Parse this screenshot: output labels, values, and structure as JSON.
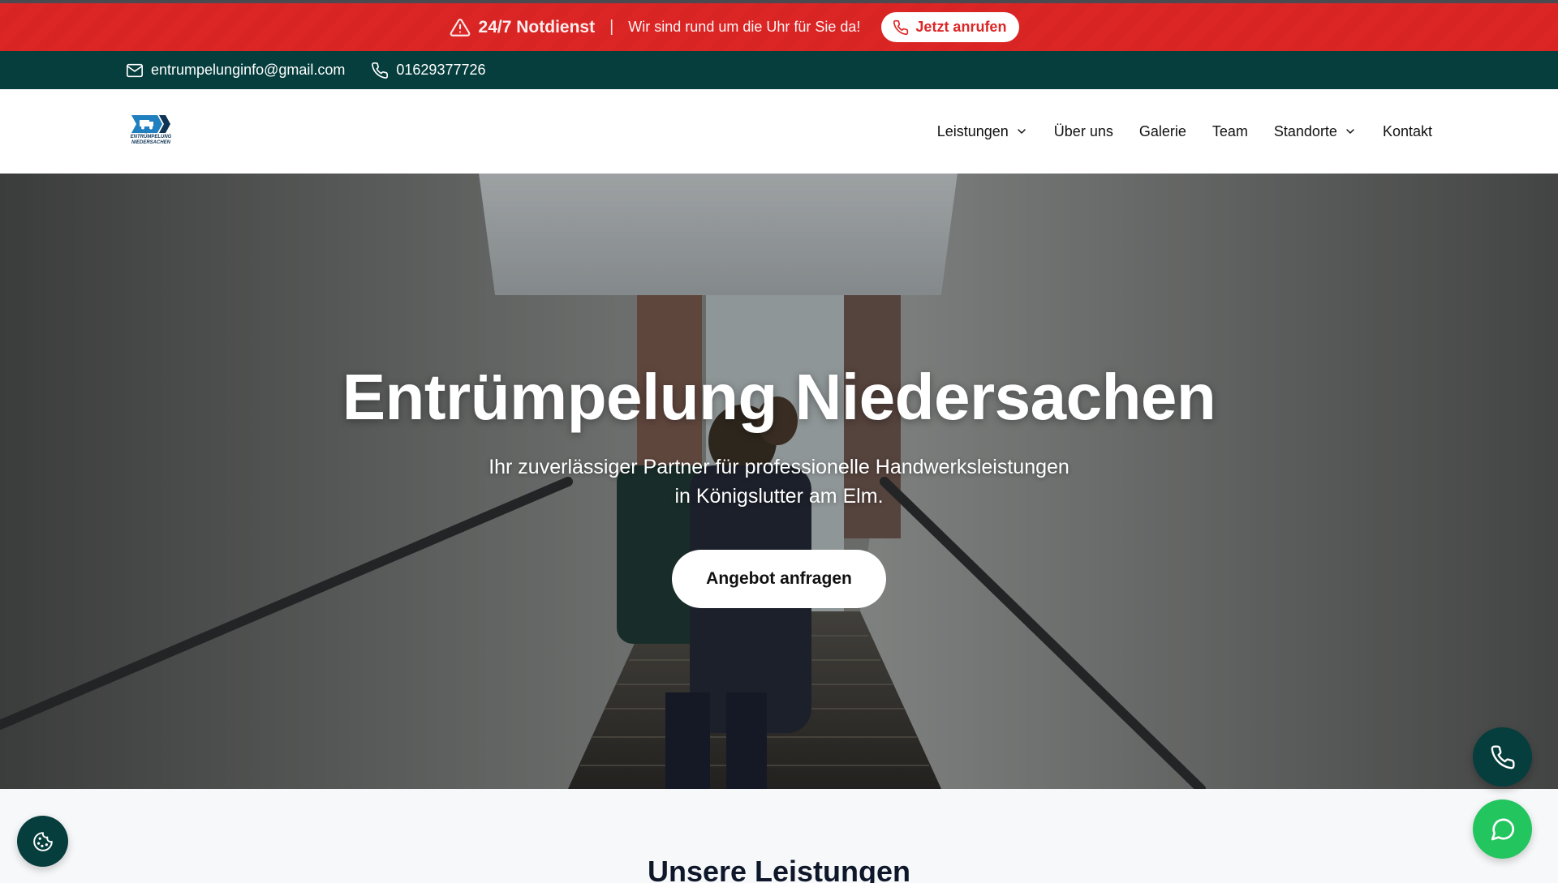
{
  "alert": {
    "title": "24/7 Notdienst",
    "separator": "|",
    "text": "Wir sind rund um die Uhr für Sie da!",
    "call_label": "Jetzt anrufen",
    "icon": "warning-triangle-icon"
  },
  "contact": {
    "email": "entrumpelunginfo@gmail.com",
    "phone": "01629377726"
  },
  "logo": {
    "line1": "ENTRÜMPELUNG",
    "line2": "NIEDERSACHEN"
  },
  "nav": {
    "items": [
      {
        "label": "Leistungen",
        "dropdown": true
      },
      {
        "label": "Über uns",
        "dropdown": false
      },
      {
        "label": "Galerie",
        "dropdown": false
      },
      {
        "label": "Team",
        "dropdown": false
      },
      {
        "label": "Standorte",
        "dropdown": true
      },
      {
        "label": "Kontakt",
        "dropdown": false
      }
    ]
  },
  "hero": {
    "title": "Entrümpelung Niedersachen",
    "subtitle_line1": "Ihr zuverlässiger Partner für professionelle Handwerksleistungen",
    "subtitle_line2": "in Königslutter am Elm.",
    "cta_label": "Angebot anfragen"
  },
  "services": {
    "title": "Unsere Leistungen"
  },
  "colors": {
    "alert_red": "#dc2626",
    "dark_teal": "#063d3d",
    "whatsapp_green": "#22c55e"
  }
}
